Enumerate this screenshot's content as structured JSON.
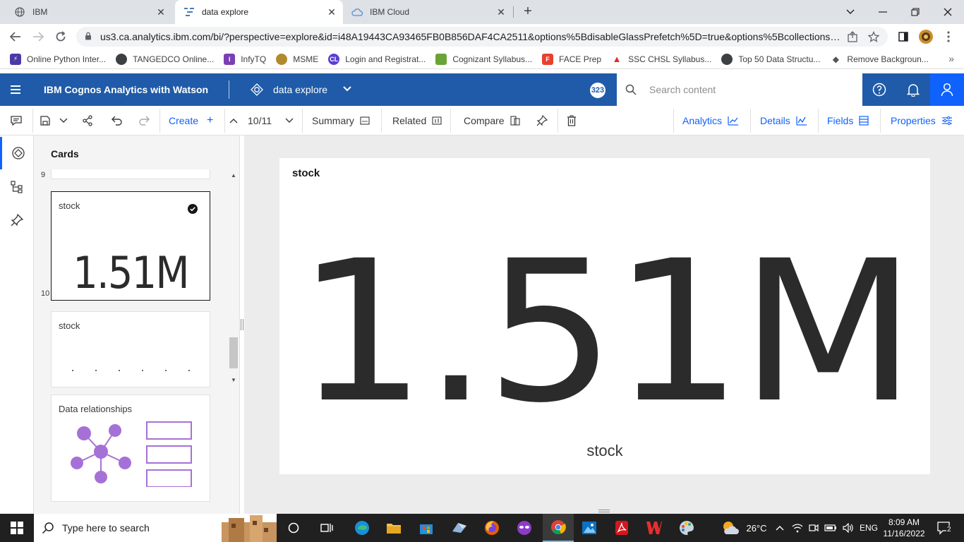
{
  "browser": {
    "tabs": [
      {
        "label": "IBM"
      },
      {
        "label": "data explore"
      },
      {
        "label": "IBM Cloud"
      }
    ],
    "url": "us3.ca.analytics.ibm.com/bi/?perspective=explore&id=i48A19443CA93465FB0B856DAF4CA2511&options%5BdisableGlassPrefetch%5D=true&options%5Bcollections%5...",
    "bookmarks": [
      {
        "label": "Online Python Inter...",
        "color": "#4a3aa8"
      },
      {
        "label": "TANGEDCO Online...",
        "color": "#3c4043"
      },
      {
        "label": "InfyTQ",
        "color": "#7b3fb5"
      },
      {
        "label": "MSME",
        "color": "#b08a2c"
      },
      {
        "label": "Login and Registrat...",
        "color": "#5b3fd1"
      },
      {
        "label": "Cognizant Syllabus...",
        "color": "#6aa336"
      },
      {
        "label": "FACE Prep",
        "color": "#e8402f"
      },
      {
        "label": "SSC CHSL Syllabus...",
        "color": "#d9302b"
      },
      {
        "label": "Top 50 Data Structu...",
        "color": "#3c4043"
      },
      {
        "label": "Remove Backgroun...",
        "color": "#555"
      }
    ]
  },
  "header": {
    "app_name": "IBM Cognos Analytics with Watson",
    "explore_name": "data explore",
    "notifications_badge": "323",
    "search_placeholder": "Search content",
    "accent": "#1f5ba8"
  },
  "toolbar": {
    "create_label": "Create",
    "page_indicator": "10/11",
    "summary_label": "Summary",
    "related_label": "Related",
    "compare_label": "Compare",
    "analytics_label": "Analytics",
    "details_label": "Details",
    "fields_label": "Fields",
    "properties_label": "Properties"
  },
  "cards_panel": {
    "title": "Cards",
    "card_numbers": [
      "9",
      "10"
    ],
    "cards": [
      {
        "title": "stock",
        "value": "1.51M",
        "selected": true
      },
      {
        "title": "stock"
      },
      {
        "title": "Data relationships"
      }
    ]
  },
  "main_card": {
    "title": "stock",
    "value": "1.51M",
    "caption": "stock"
  },
  "taskbar": {
    "search_placeholder": "Type here to search",
    "temperature": "26°C",
    "language": "ENG",
    "time": "8:09 AM",
    "date": "11/16/2022",
    "notification_count": "2"
  }
}
